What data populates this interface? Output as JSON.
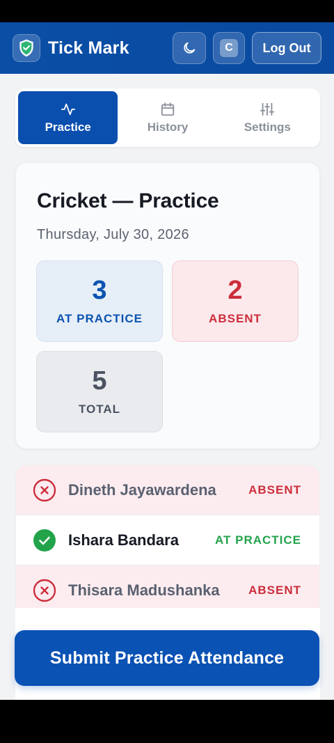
{
  "app": {
    "title": "Tick Mark"
  },
  "header": {
    "avatar_initial": "C",
    "logout_label": "Log Out"
  },
  "tabs": [
    {
      "label": "Practice",
      "icon": "activity-icon",
      "active": true
    },
    {
      "label": "History",
      "icon": "calendar-icon",
      "active": false
    },
    {
      "label": "Settings",
      "icon": "sliders-icon",
      "active": false
    }
  ],
  "session": {
    "title": "Cricket — Practice",
    "date": "Thursday, July 30, 2026"
  },
  "stats": {
    "practice": {
      "value": "3",
      "label": "AT PRACTICE"
    },
    "absent": {
      "value": "2",
      "label": "ABSENT"
    },
    "total": {
      "value": "5",
      "label": "TOTAL"
    }
  },
  "players": [
    {
      "name": "Dineth Jayawardena",
      "status": "ABSENT"
    },
    {
      "name": "Ishara Bandara",
      "status": "AT PRACTICE"
    },
    {
      "name": "Thisara Madushanka",
      "status": "ABSENT"
    }
  ],
  "submit_label": "Submit Practice Attendance",
  "colors": {
    "primary": "#0a4fae",
    "absent": "#cc2d3b",
    "present": "#22a34a"
  }
}
